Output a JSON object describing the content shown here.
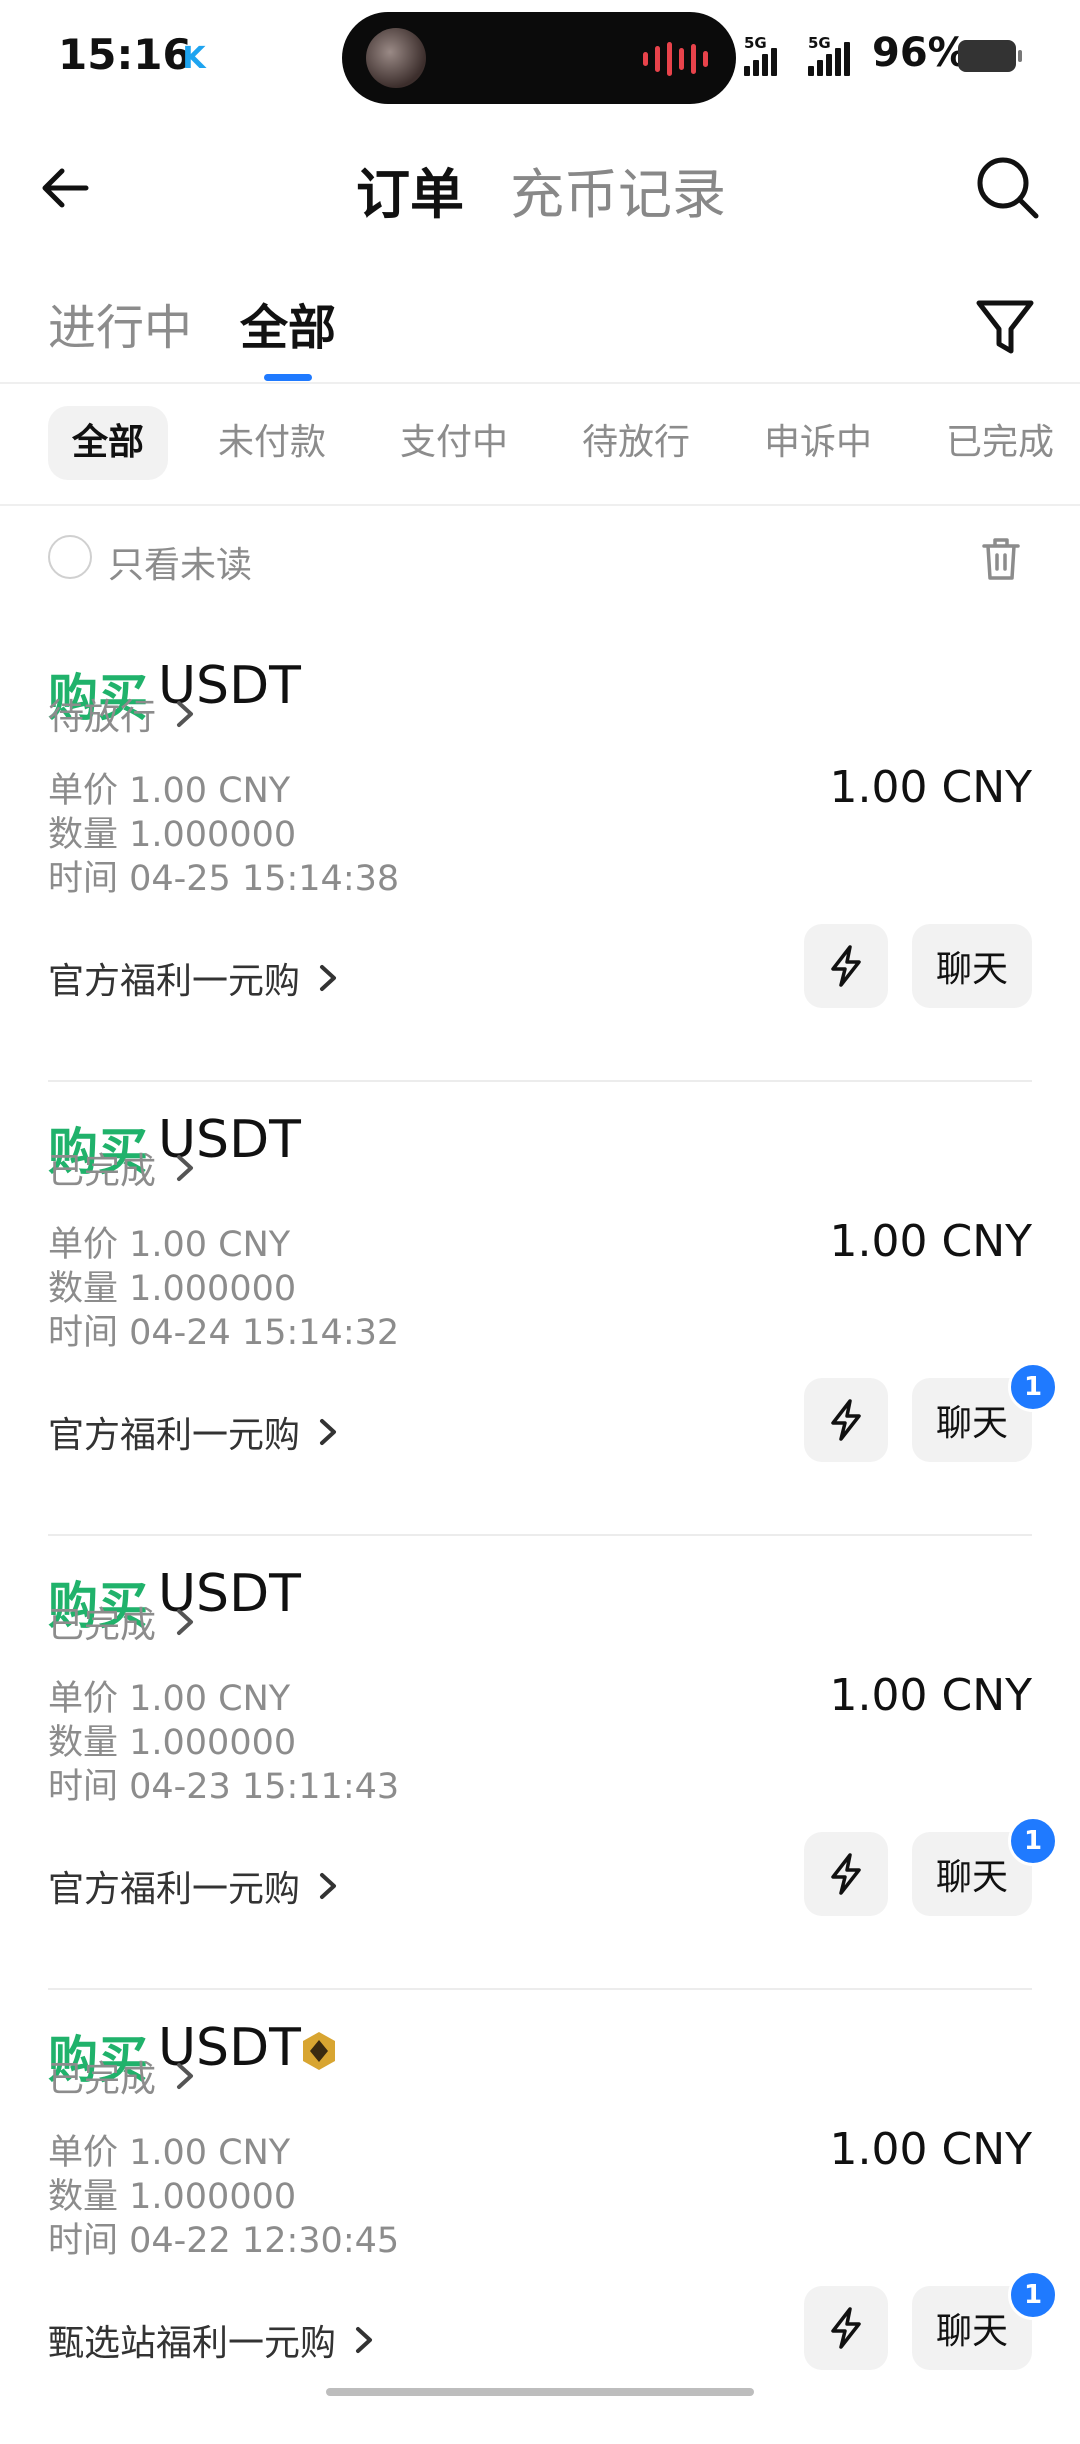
{
  "status_bar": {
    "time": "15:16",
    "app_icon_letter": "K",
    "net1": "5G",
    "net2": "5G",
    "battery": "96%"
  },
  "header": {
    "title": "订单",
    "title_alt": "充币记录"
  },
  "tabs": {
    "in_progress": "进行中",
    "all": "全部"
  },
  "status_filters": [
    "全部",
    "未付款",
    "支付中",
    "待放行",
    "申诉中",
    "已完成"
  ],
  "unread_only_label": "只看未读",
  "orders": [
    {
      "side": "购买",
      "coin": "USDT",
      "vip": false,
      "status": "待放行",
      "unit_price": "单价 1.00 CNY",
      "quantity": "数量 1.000000",
      "time": "时间  04-25 15:14:38",
      "amount": "1.00 CNY",
      "promo": "官方福利一元购",
      "chat_label": "聊天",
      "unread_count": ""
    },
    {
      "side": "购买",
      "coin": "USDT",
      "vip": false,
      "status": "已完成",
      "unit_price": "单价 1.00 CNY",
      "quantity": "数量 1.000000",
      "time": "时间  04-24 15:14:32",
      "amount": "1.00 CNY",
      "promo": "官方福利一元购",
      "chat_label": "聊天",
      "unread_count": "1"
    },
    {
      "side": "购买",
      "coin": "USDT",
      "vip": false,
      "status": "已完成",
      "unit_price": "单价 1.00 CNY",
      "quantity": "数量 1.000000",
      "time": "时间  04-23 15:11:43",
      "amount": "1.00 CNY",
      "promo": "官方福利一元购",
      "chat_label": "聊天",
      "unread_count": "1"
    },
    {
      "side": "购买",
      "coin": "USDT",
      "vip": true,
      "status": "已完成",
      "unit_price": "单价 1.00 CNY",
      "quantity": "数量 1.000000",
      "time": "时间  04-22 12:30:45",
      "amount": "1.00 CNY",
      "promo": "甄选站福利一元购",
      "chat_label": "聊天",
      "unread_count": "1"
    }
  ],
  "colors": {
    "buy_green": "#20b26b",
    "accent_blue": "#1f7aff",
    "muted_gray": "#8c8c8c"
  }
}
